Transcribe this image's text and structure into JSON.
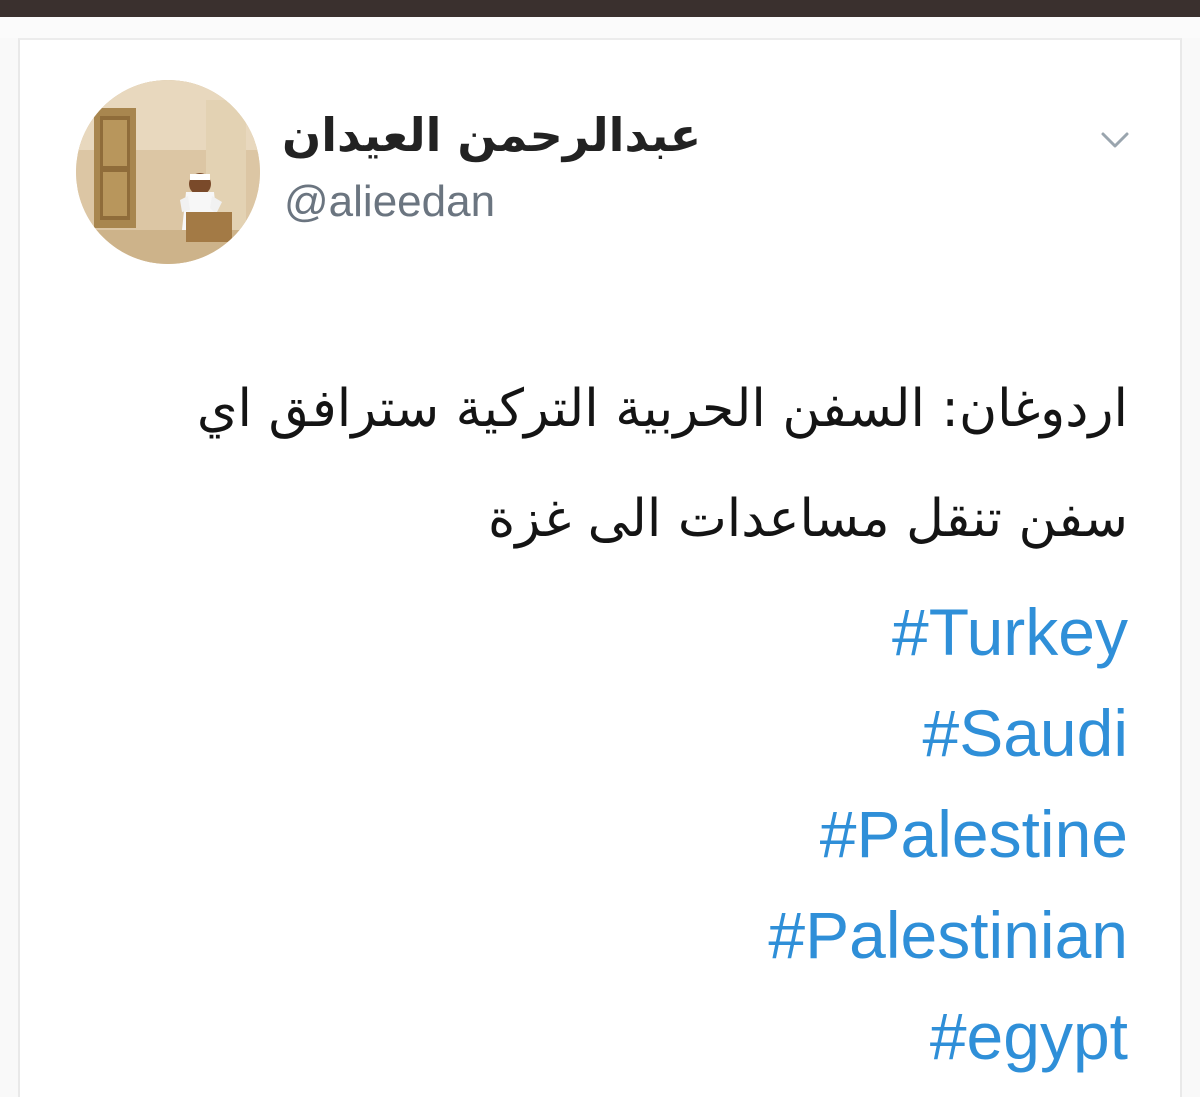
{
  "author": {
    "name": "عبدالرحمن العيدان",
    "handle": "@alieedan"
  },
  "tweet": {
    "lines": [
      "اردوغان: السفن الحربية التركية سترافق اي",
      "سفن تنقل مساعدات الى غزة"
    ],
    "hashtags": [
      "#Turkey",
      "#Saudi",
      "#Palestine",
      "#Palestinian",
      "#egypt"
    ]
  },
  "icons": {
    "menu": "chevron-down-icon",
    "avatar": "profile-photo"
  },
  "colors": {
    "hashtag": "#2f8fd8",
    "handle": "#6b7580",
    "text": "#141414",
    "top_bar": "#3a302e"
  }
}
